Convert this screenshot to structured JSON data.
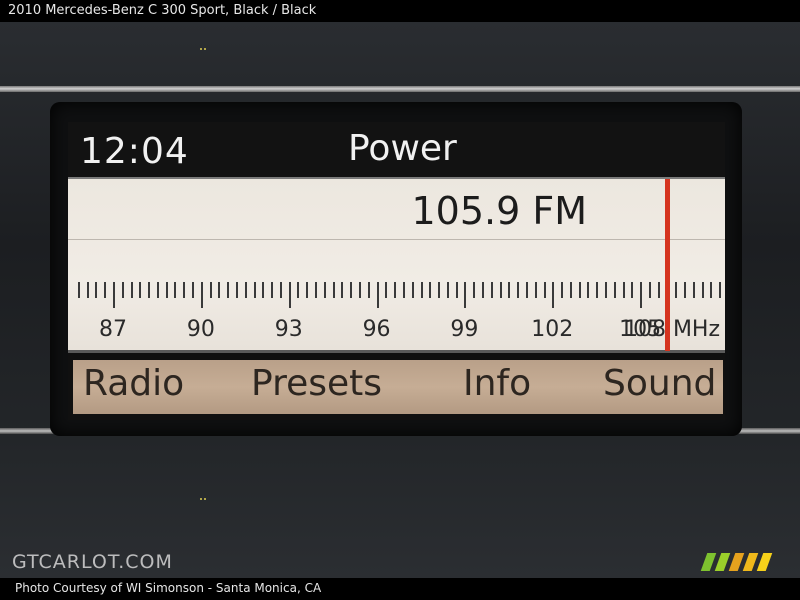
{
  "caption": "2010 Mercedes-Benz C 300 Sport,  Black / Black",
  "screen": {
    "clock": "12:04",
    "source_title": "Power",
    "frequency_display": "105.9 FM",
    "tuned_frequency_mhz": 105.9,
    "scale": {
      "labels": [
        "87",
        "90",
        "93",
        "96",
        "99",
        "102",
        "105",
        "108 MHz"
      ],
      "min_mhz": 87,
      "max_mhz": 108
    },
    "softkeys": [
      "Radio",
      "Presets",
      "Info",
      "Sound"
    ],
    "colors": {
      "needle": "#d5341f",
      "tuner_background": "#ece7df",
      "softkey_bar": "#c6ad95"
    }
  },
  "watermark": "GTCARLOT.COM",
  "credit": "Photo Courtesy of WI Simonson - Santa Monica, CA",
  "stripe_colors": [
    "#7ec22f",
    "#9bcf2a",
    "#e6a21e",
    "#f0b91b",
    "#f6d11a"
  ]
}
